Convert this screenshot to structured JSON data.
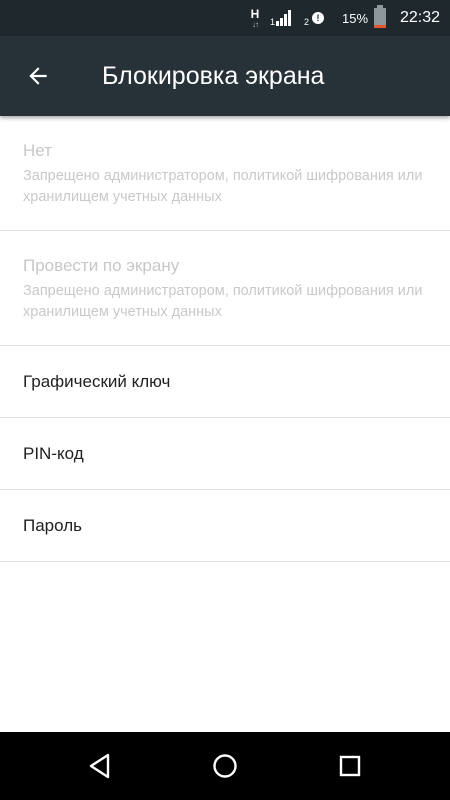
{
  "status_bar": {
    "network_type": "H",
    "network_arrows": "↓↑",
    "sim1_index": "1",
    "sim2_index": "2",
    "sim2_alert": "!",
    "battery_percent_text": "15%",
    "battery_level": 0.15,
    "time": "22:32",
    "icons": [
      "data-activity-icon",
      "signal-icon",
      "signal-alert-icon",
      "battery-icon"
    ]
  },
  "app_bar": {
    "back_icon": "arrow-back-icon",
    "title": "Блокировка экрана"
  },
  "options": [
    {
      "title": "Нет",
      "summary": "Запрещено администратором, политикой шифрования или хранилищем учетных данных",
      "enabled": false
    },
    {
      "title": "Провести по экрану",
      "summary": "Запрещено администратором, политикой шифрования или хранилищем учетных данных",
      "enabled": false
    },
    {
      "title": "Графический ключ",
      "enabled": true
    },
    {
      "title": "PIN-код",
      "enabled": true
    },
    {
      "title": "Пароль",
      "enabled": true
    }
  ],
  "nav_bar": {
    "icons": [
      "nav-back-icon",
      "nav-home-icon",
      "nav-recents-icon"
    ]
  },
  "colors": {
    "status_bar_bg": "#1f292d",
    "app_bar_bg": "#263238",
    "disabled_text": "#c7c7c7",
    "primary_text": "#212121",
    "battery_low": "#e4572e"
  }
}
